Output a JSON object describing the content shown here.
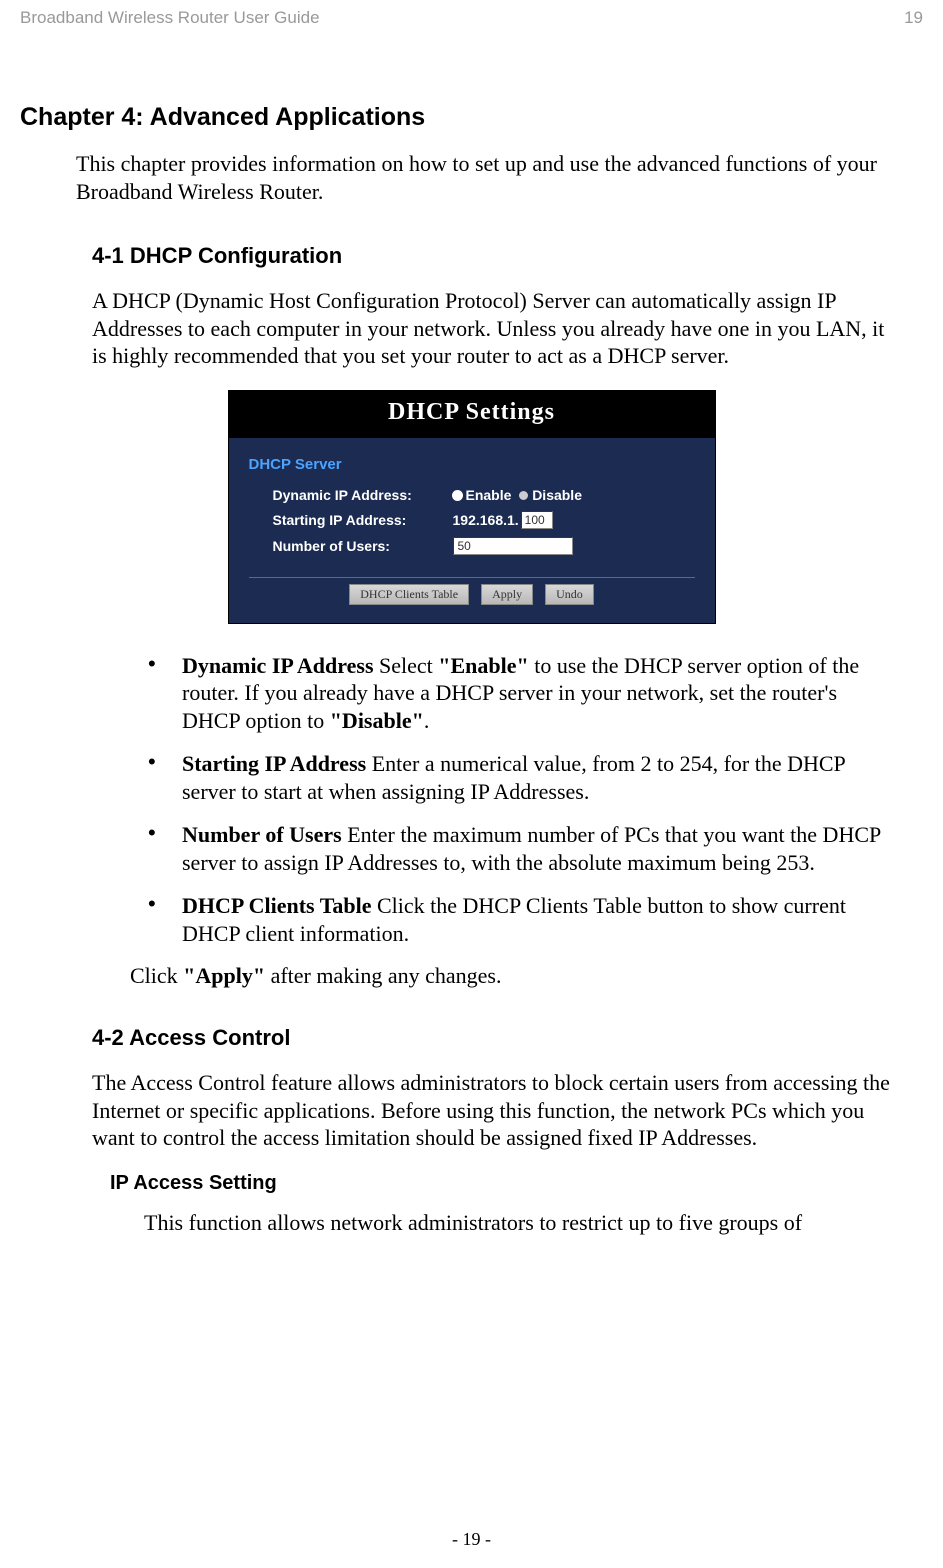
{
  "header": {
    "doc_title": "Broadband Wireless Router User Guide",
    "page_num_top": "19"
  },
  "chapter": {
    "title": "Chapter 4: Advanced Applications",
    "intro": "This chapter provides information on how to set up and use the advanced functions of your Broadband Wireless Router."
  },
  "sec41": {
    "title": "4-1 DHCP Configuration",
    "para": "A DHCP (Dynamic Host Configuration Protocol) Server can automatically assign IP Addresses to each computer in your network. Unless you already have one in you LAN, it is highly recommended that you set your router to act as a DHCP server.",
    "panel": {
      "title": "DHCP Settings",
      "server_label": "DHCP Server",
      "dyn_ip_label": "Dynamic IP Address:",
      "enable": "Enable",
      "disable": "Disable",
      "start_ip_label": "Starting IP Address:",
      "ip_prefix": "192.168.1.",
      "ip_last": "100",
      "num_users_label": "Number of Users:",
      "num_users_val": "50",
      "btn_table": "DHCP Clients Table",
      "btn_apply": "Apply",
      "btn_undo": "Undo"
    },
    "bullets": {
      "b1_strong": "Dynamic IP Address",
      "b1_a": " Select ",
      "b1_enable": "\"Enable\"",
      "b1_b": " to use the DHCP server option of the router. If you already have a DHCP server in your network, set the router's DHCP option to ",
      "b1_disable": "\"Disable\"",
      "b1_c": ".",
      "b2_strong": "Starting IP Address",
      "b2_a": " Enter a numerical value, from 2 to 254, for the DHCP server to start at when assigning IP Addresses.",
      "b3_strong": "Number of Users",
      "b3_a": " Enter the maximum number of PCs that you want the DHCP server to assign IP Addresses to, with the absolute maximum being 253.",
      "b4_strong": "DHCP Clients Table",
      "b4_a": " Click the DHCP Clients Table button to show current DHCP client information."
    },
    "apply_a": "Click ",
    "apply_b": "\"Apply\"",
    "apply_c": " after making any changes."
  },
  "sec42": {
    "title": "4-2 Access Control",
    "para": "The Access Control feature allows administrators to block certain users from accessing the Internet or specific applications. Before using this function, the network PCs which you want to control the access limitation should be assigned fixed IP Addresses.",
    "sub_title": "IP Access Setting",
    "sub_para": "This function allows network administrators to restrict up to five groups of"
  },
  "footer": {
    "page": "- 19 -"
  }
}
